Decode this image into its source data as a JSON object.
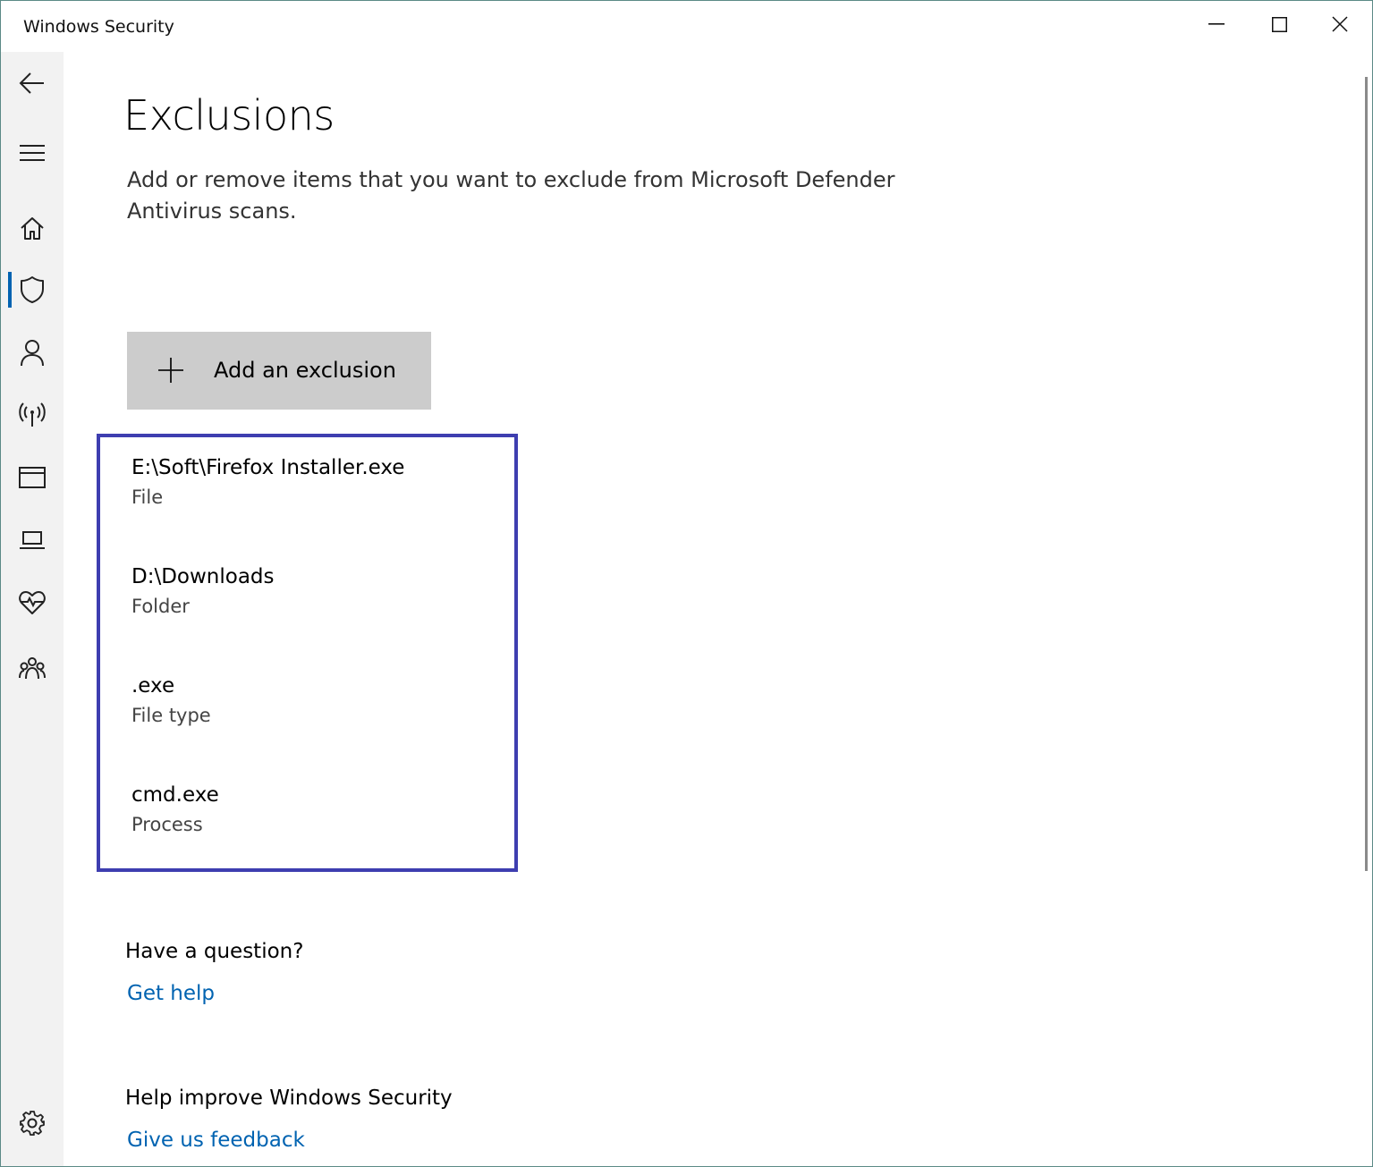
{
  "window": {
    "title": "Windows Security",
    "controls": {
      "minimize": "minimize-icon",
      "maximize": "maximize-icon",
      "close": "close-icon"
    }
  },
  "sidebar": {
    "items": [
      {
        "id": "back",
        "icon": "back-arrow-icon"
      },
      {
        "id": "menu",
        "icon": "hamburger-menu-icon"
      },
      {
        "id": "home",
        "icon": "home-icon"
      },
      {
        "id": "virus-protection",
        "icon": "shield-icon",
        "active": true
      },
      {
        "id": "account-protection",
        "icon": "person-icon"
      },
      {
        "id": "firewall",
        "icon": "antenna-icon"
      },
      {
        "id": "app-browser",
        "icon": "browser-window-icon"
      },
      {
        "id": "device-security",
        "icon": "laptop-icon"
      },
      {
        "id": "device-health",
        "icon": "heart-pulse-icon"
      },
      {
        "id": "family-options",
        "icon": "family-icon"
      },
      {
        "id": "settings",
        "icon": "gear-icon"
      }
    ],
    "accent_color": "#0063b1"
  },
  "main": {
    "title": "Exclusions",
    "description": "Add or remove items that you want to exclude from Microsoft Defender Antivirus scans.",
    "add_button_label": "Add an exclusion",
    "exclusions": [
      {
        "name": "E:\\Soft\\Firefox Installer.exe",
        "type": "File"
      },
      {
        "name": "D:\\Downloads",
        "type": "Folder"
      },
      {
        "name": ".exe",
        "type": "File type"
      },
      {
        "name": "cmd.exe",
        "type": "Process"
      }
    ],
    "question_heading": "Have a question?",
    "get_help_link": "Get help",
    "improve_heading": "Help improve Windows Security",
    "feedback_link": "Give us feedback"
  },
  "colors": {
    "link": "#0063b1",
    "highlight_border": "#3e3eb0",
    "button_bg": "#cccccc",
    "sidebar_bg": "#f2f2f2"
  }
}
